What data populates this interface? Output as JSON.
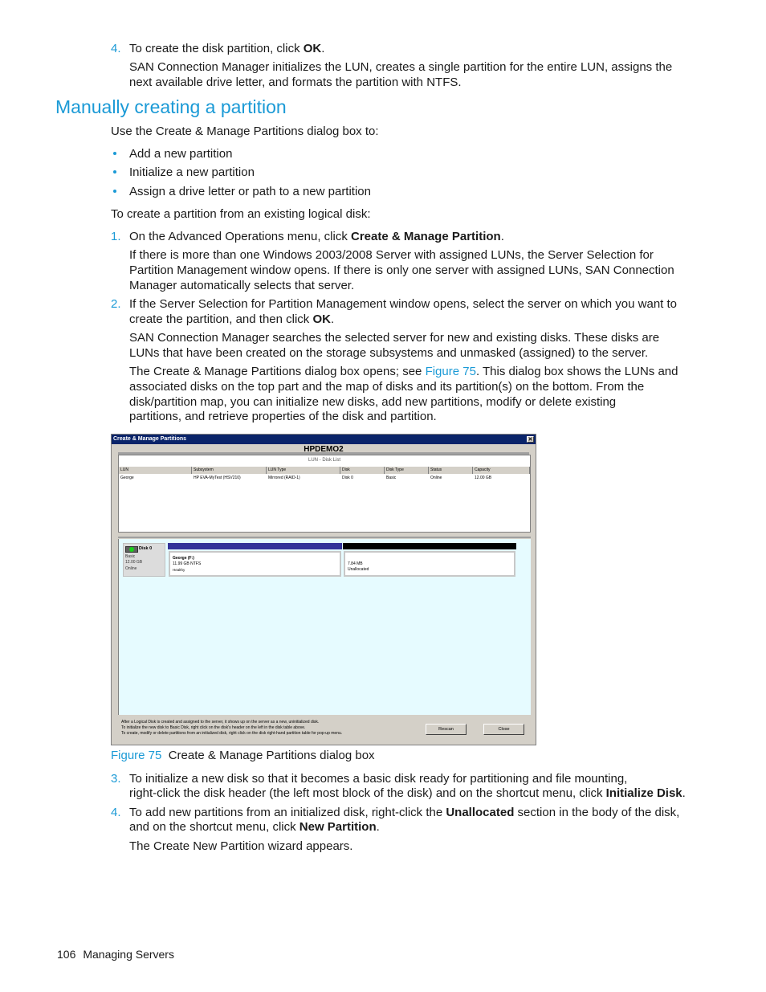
{
  "intro": {
    "step4_num": "4.",
    "step4_pre": "To create the disk partition, click ",
    "step4_bold": "OK",
    "step4_post": ".",
    "step4_desc_line1": "SAN Connection Manager initializes the LUN, creates a single partition for the entire LUN, assigns the",
    "step4_desc_line2": "next available drive letter, and formats the partition with NTFS."
  },
  "section": {
    "heading": "Manually creating a partition",
    "lead": "Use the Create & Manage Partitions dialog box to:",
    "bullets": [
      "Add a new partition",
      "Initialize a new partition",
      "Assign a drive letter or path to a new partition"
    ],
    "lead2": "To create a partition from an existing logical disk:"
  },
  "steps": {
    "s1_num": "1.",
    "s1_pre": "On the Advanced Operations menu, click ",
    "s1_bold": "Create & Manage Partition",
    "s1_post": ".",
    "s1_desc": [
      "If there is more than one Windows 2003/2008 Server with assigned LUNs, the Server Selection for",
      "Partition Management window opens. If there is only one server with assigned LUNs, SAN Connection",
      "Manager automatically selects that server."
    ],
    "s2_num": "2.",
    "s2_line1": "If the Server Selection for Partition Management window opens, select the server on which you want to",
    "s2_line2_pre": "create the partition, and then click ",
    "s2_line2_bold": "OK",
    "s2_line2_post": ".",
    "s2_desc": [
      "SAN Connection Manager searches the selected server for new and existing disks. These disks are",
      "LUNs that have been created on the storage subsystems and unmasked (assigned) to the server."
    ],
    "s2_desc2_pre": "The Create & Manage Partitions dialog box opens; see ",
    "s2_desc2_link": "Figure 75",
    "s2_desc2_post": ". This dialog box shows the LUNs and",
    "s2_desc2_rest": [
      "associated disks on the top part and the map of disks and its partition(s) on the bottom. From the",
      "disk/partition map, you can initialize new disks, add new partitions, modify or delete existing",
      "partitions, and retrieve properties of the disk and partition."
    ],
    "s3_num": "3.",
    "s3_line1": "To initialize a new disk so that it becomes a basic disk ready for partitioning and file mounting,",
    "s3_line2_pre": "right-click the disk header (the left most block of the disk) and on the shortcut menu, click ",
    "s3_line2_bold": "Initialize Disk",
    "s3_line2_post": ".",
    "s4_num": "4.",
    "s4_line1_pre": "To add new partitions from an initialized disk, right-click the ",
    "s4_line1_bold": "Unallocated",
    "s4_line1_post": " section in the body of the disk,",
    "s4_line2_pre": "and on the shortcut menu, click ",
    "s4_line2_bold": "New Partition",
    "s4_line2_post": ".",
    "s4_desc": "The Create New Partition wizard appears."
  },
  "figure": {
    "label": "Figure 75",
    "caption": "Create & Manage Partitions dialog box"
  },
  "dialog": {
    "title": "Create & Manage Partitions",
    "close_glyph": "✕",
    "server": "HPDEMO2",
    "list_title": "LUN - Disk List",
    "columns": [
      "LUN",
      "Subsystem",
      "LUN Type",
      "Disk",
      "Disk Type",
      "Status",
      "Capacity"
    ],
    "rows": [
      [
        "George",
        "HP EVA-MyTest (HSV210)",
        "Mirrored (RAID-1)",
        "Disk 0",
        "Basic",
        "Online",
        "12.00 GB"
      ]
    ],
    "disk": {
      "name": "Disk 0",
      "type": "Basic",
      "size": "12.00 GB",
      "status": "Online"
    },
    "partitions": [
      {
        "name": "George (F:)",
        "size": "11.99 GB NTFS",
        "state": "Healthy",
        "bar_color": "#333399"
      },
      {
        "name": "",
        "size": "7.84 MB",
        "state": "Unallocated",
        "bar_color": "#000000"
      }
    ],
    "hints": [
      "After a Logical Disk is created and assigned to the server, it shows up on the server as a new, uninitialized disk.",
      "To initialize the new disk to Basic Disk, right click on the disk's header on the left in the disk table above.",
      "To create, modify or delete partitions from an initialized disk, right click on the disk right-hand partition table for pop-up menu."
    ],
    "rescan_label": "Rescan",
    "close_label": "Close"
  },
  "footer": {
    "page_number": "106",
    "section": "Managing Servers"
  }
}
